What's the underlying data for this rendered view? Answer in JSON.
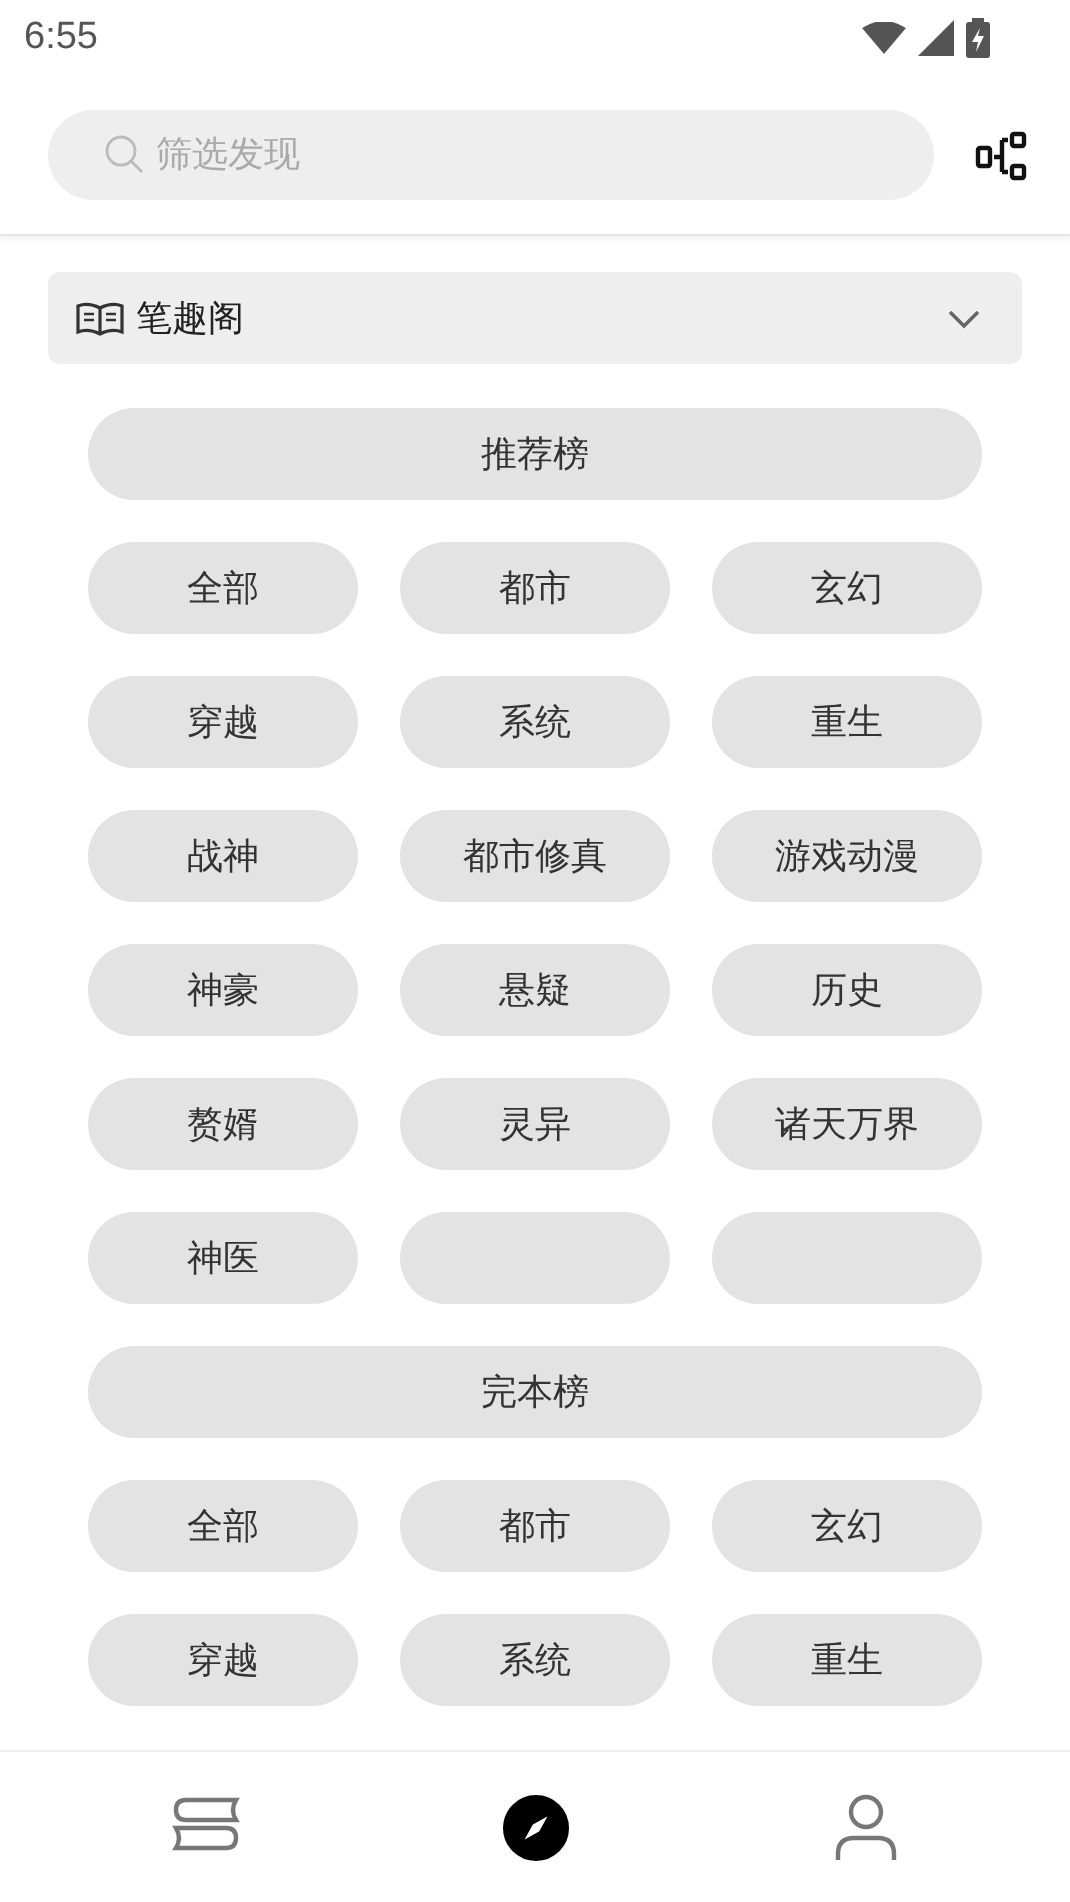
{
  "status_bar": {
    "time": "6:55"
  },
  "search": {
    "placeholder": "筛选发现"
  },
  "source": {
    "name": "笔趣阁",
    "expanded": false
  },
  "sections": [
    {
      "title": "推荐榜",
      "tags": [
        {
          "kind": "tag",
          "label": "全部"
        },
        {
          "kind": "tag",
          "label": "都市"
        },
        {
          "kind": "tag",
          "label": "玄幻"
        },
        {
          "kind": "tag",
          "label": "穿越"
        },
        {
          "kind": "tag",
          "label": "系统"
        },
        {
          "kind": "tag",
          "label": "重生"
        },
        {
          "kind": "tag",
          "label": "战神"
        },
        {
          "kind": "tag",
          "label": "都市修真"
        },
        {
          "kind": "tag",
          "label": "游戏动漫"
        },
        {
          "kind": "tag",
          "label": "神豪"
        },
        {
          "kind": "tag",
          "label": "悬疑"
        },
        {
          "kind": "tag",
          "label": "历史"
        },
        {
          "kind": "tag",
          "label": "赘婿"
        },
        {
          "kind": "tag",
          "label": "灵异"
        },
        {
          "kind": "tag",
          "label": "诸天万界"
        },
        {
          "kind": "tag",
          "label": "神医"
        },
        {
          "kind": "empty"
        },
        {
          "kind": "empty"
        }
      ]
    },
    {
      "title": "完本榜",
      "tags": [
        {
          "kind": "tag",
          "label": "全部"
        },
        {
          "kind": "tag",
          "label": "都市"
        },
        {
          "kind": "tag",
          "label": "玄幻"
        },
        {
          "kind": "tag",
          "label": "穿越"
        },
        {
          "kind": "tag",
          "label": "系统"
        },
        {
          "kind": "tag",
          "label": "重生"
        }
      ]
    }
  ],
  "nav": [
    {
      "kind": "bookshelf",
      "selected": false
    },
    {
      "kind": "explore",
      "selected": true
    },
    {
      "kind": "profile",
      "selected": false
    }
  ]
}
